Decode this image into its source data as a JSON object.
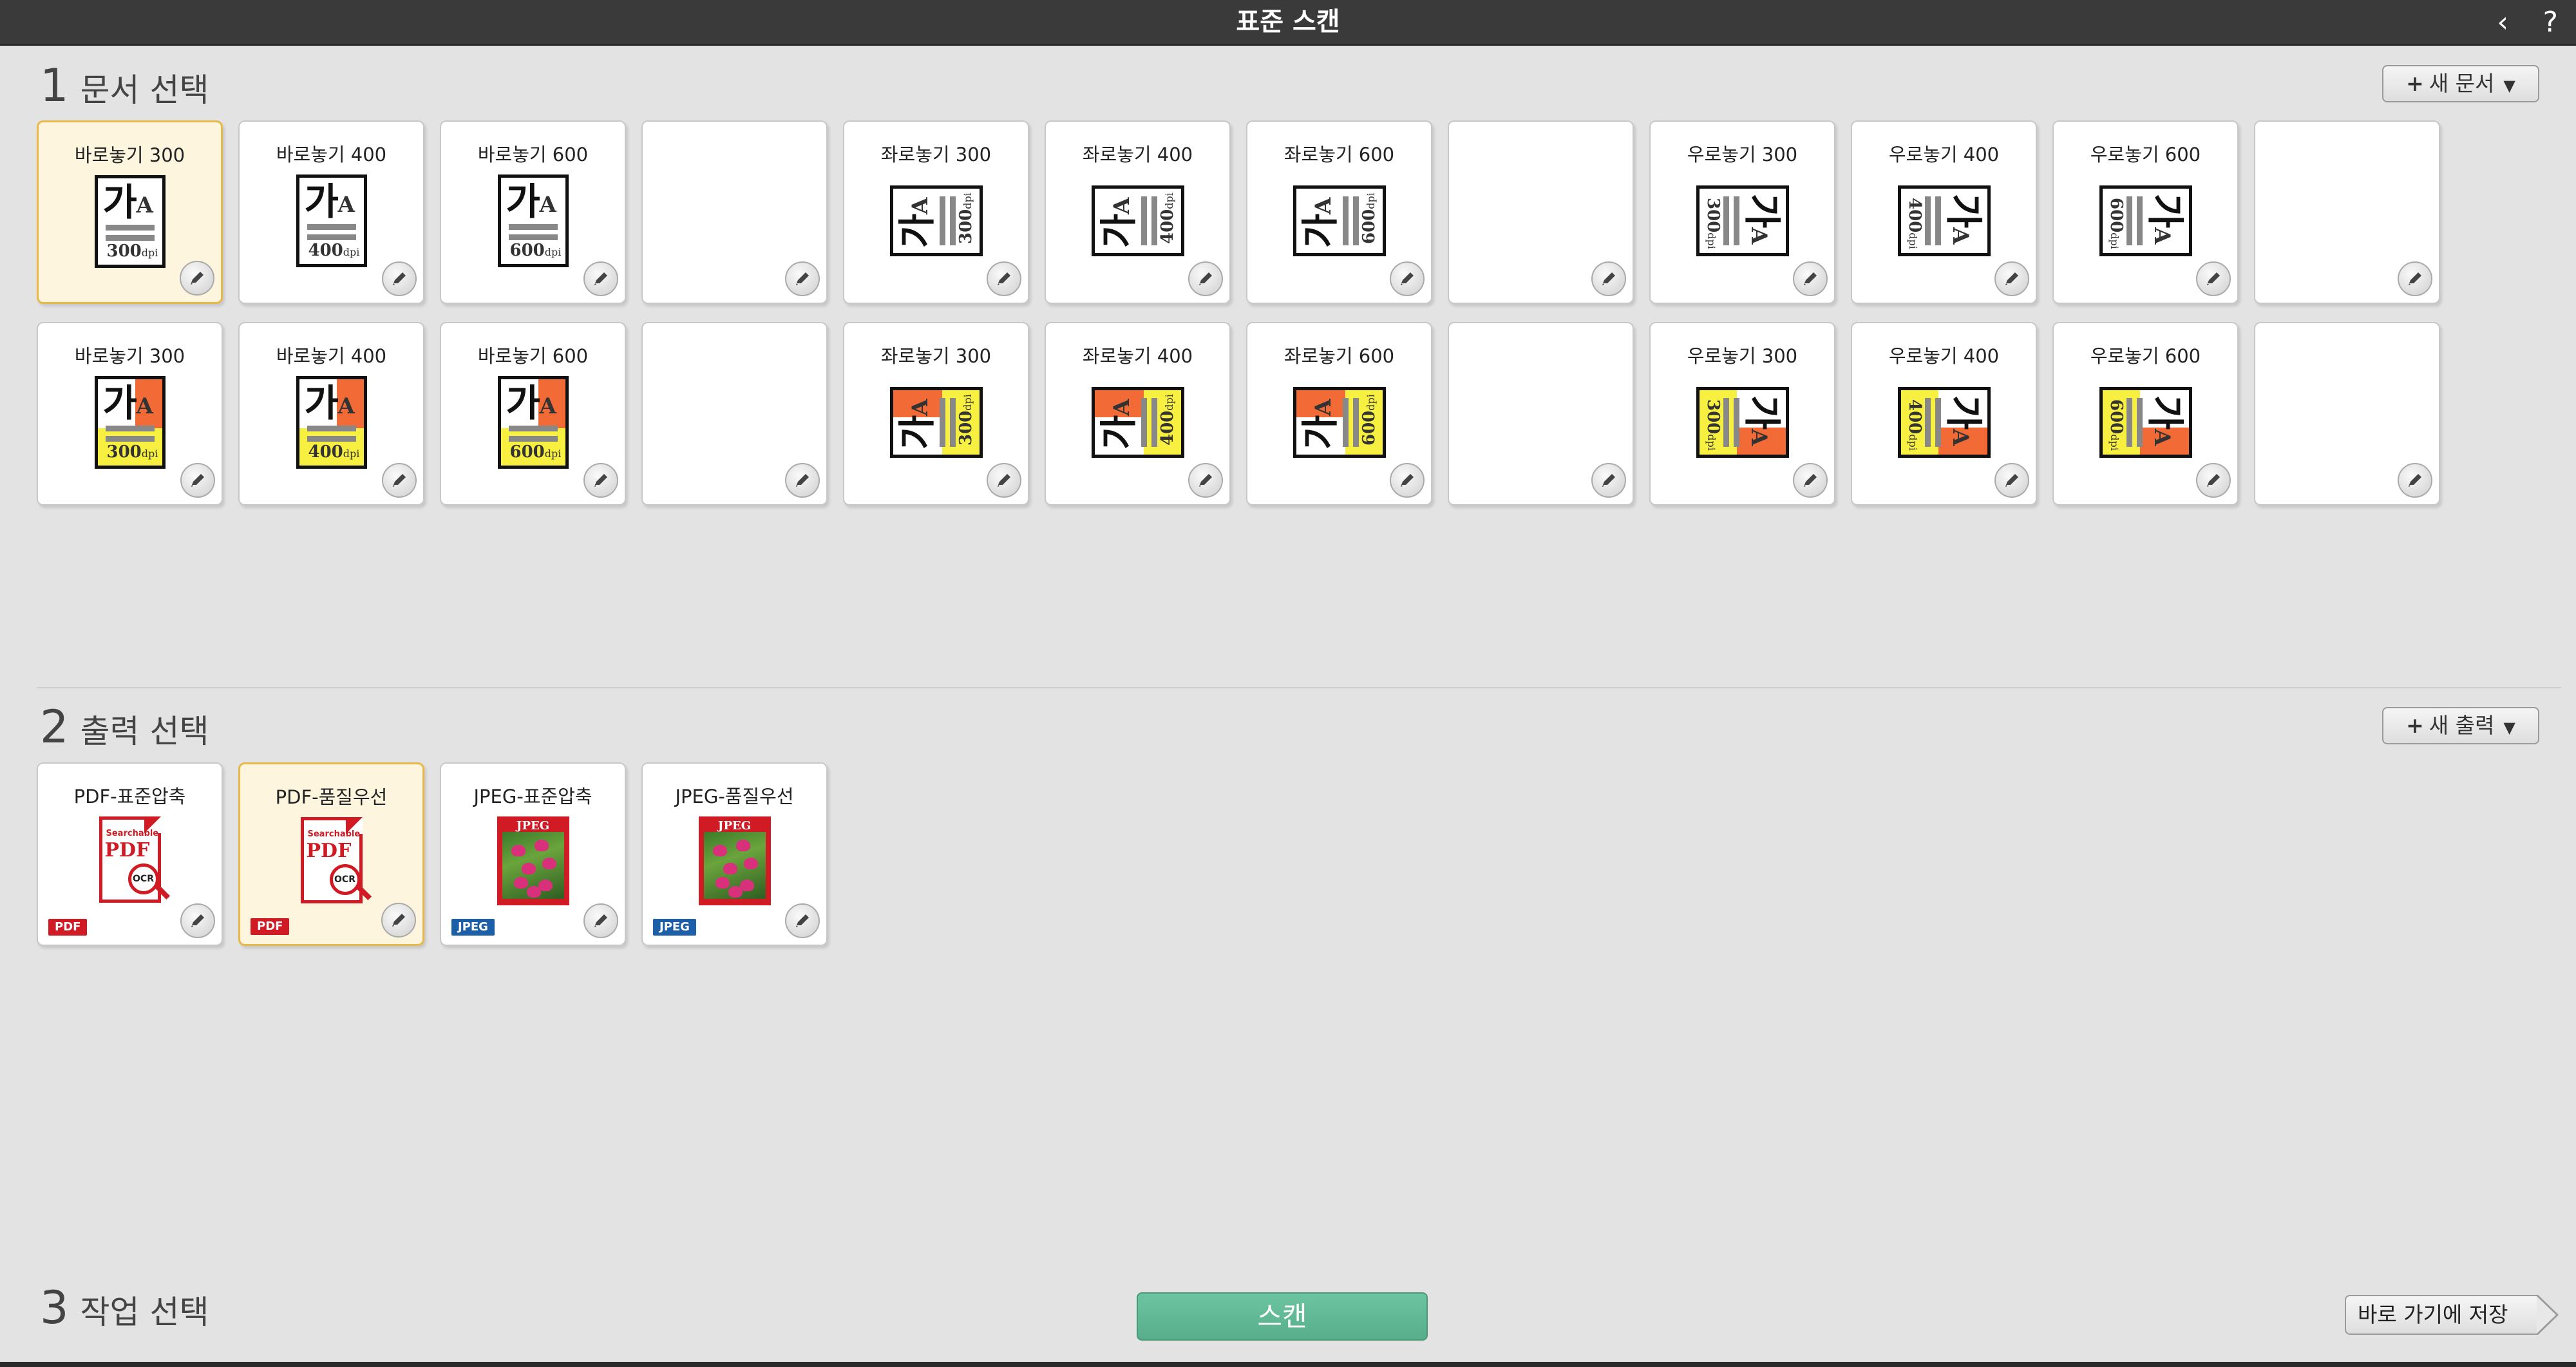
{
  "window": {
    "title": "표준 스캔",
    "back_glyph": "‹",
    "help_glyph": "?"
  },
  "section1": {
    "number": "1",
    "title": "문서 선택",
    "add_button": "새 문서",
    "profiles": [
      {
        "label": "바로놓기 300",
        "kind": "upright",
        "dpi": "300",
        "color": "mono",
        "selected": true
      },
      {
        "label": "바로놓기 400",
        "kind": "upright",
        "dpi": "400",
        "color": "mono"
      },
      {
        "label": "바로놓기 600",
        "kind": "upright",
        "dpi": "600",
        "color": "mono"
      },
      {
        "label": "",
        "kind": "empty"
      },
      {
        "label": "좌로놓기 300",
        "kind": "left",
        "dpi": "300",
        "color": "mono"
      },
      {
        "label": "좌로놓기 400",
        "kind": "left",
        "dpi": "400",
        "color": "mono"
      },
      {
        "label": "좌로놓기 600",
        "kind": "left",
        "dpi": "600",
        "color": "mono"
      },
      {
        "label": "",
        "kind": "empty"
      },
      {
        "label": "우로놓기 300",
        "kind": "right",
        "dpi": "300",
        "color": "mono"
      },
      {
        "label": "우로놓기 400",
        "kind": "right",
        "dpi": "400",
        "color": "mono"
      },
      {
        "label": "우로놓기 600",
        "kind": "right",
        "dpi": "600",
        "color": "mono"
      },
      {
        "label": "",
        "kind": "empty"
      },
      {
        "label": "바로놓기 300",
        "kind": "upright",
        "dpi": "300",
        "color": "color"
      },
      {
        "label": "바로놓기  400",
        "kind": "upright",
        "dpi": "400",
        "color": "color"
      },
      {
        "label": "바로놓기 600",
        "kind": "upright",
        "dpi": "600",
        "color": "color"
      },
      {
        "label": "",
        "kind": "empty"
      },
      {
        "label": "좌로놓기 300",
        "kind": "left",
        "dpi": "300",
        "color": "color"
      },
      {
        "label": "좌로놓기 400",
        "kind": "left",
        "dpi": "400",
        "color": "color"
      },
      {
        "label": "좌로놓기 600",
        "kind": "left",
        "dpi": "600",
        "color": "color"
      },
      {
        "label": "",
        "kind": "empty"
      },
      {
        "label": "우로놓기 300",
        "kind": "right",
        "dpi": "300",
        "color": "color"
      },
      {
        "label": "우로놓기 400",
        "kind": "right",
        "dpi": "400",
        "color": "color"
      },
      {
        "label": "우로놓기 600",
        "kind": "right",
        "dpi": "600",
        "color": "color"
      },
      {
        "label": "",
        "kind": "empty"
      }
    ]
  },
  "section2": {
    "number": "2",
    "title": "출력 선택",
    "add_button": "새 출력",
    "outputs": [
      {
        "label": "PDF-표준압축",
        "type": "pdf",
        "badge": "PDF",
        "icon_sub": "Searchable",
        "icon_big": "PDF",
        "icon_lens": "OCR"
      },
      {
        "label": "PDF-품질우선",
        "type": "pdf",
        "badge": "PDF",
        "icon_sub": "Searchable",
        "icon_big": "PDF",
        "icon_lens": "OCR",
        "selected": true
      },
      {
        "label": "JPEG-표준압축",
        "type": "jpeg",
        "badge": "JPEG",
        "icon_big": "JPEG"
      },
      {
        "label": "JPEG-품질우선",
        "type": "jpeg",
        "badge": "JPEG",
        "icon_big": "JPEG"
      }
    ]
  },
  "section3": {
    "number": "3",
    "title": "작업 선택",
    "scan_button": "스캔",
    "shortcut_button": "바로 가기에 저장"
  },
  "icons": {
    "doc_glyph": "가",
    "doc_glyph_small": "A",
    "dpi_unit": "dpi"
  },
  "colors": {
    "accent_green": "#5fb592",
    "selected_fill": "#fdf5dd",
    "selected_border": "#e8b84a",
    "pdf_red": "#d01a24",
    "jpeg_blue": "#1c5ea8",
    "orange": "#f26a35",
    "yellow": "#f8f040"
  }
}
